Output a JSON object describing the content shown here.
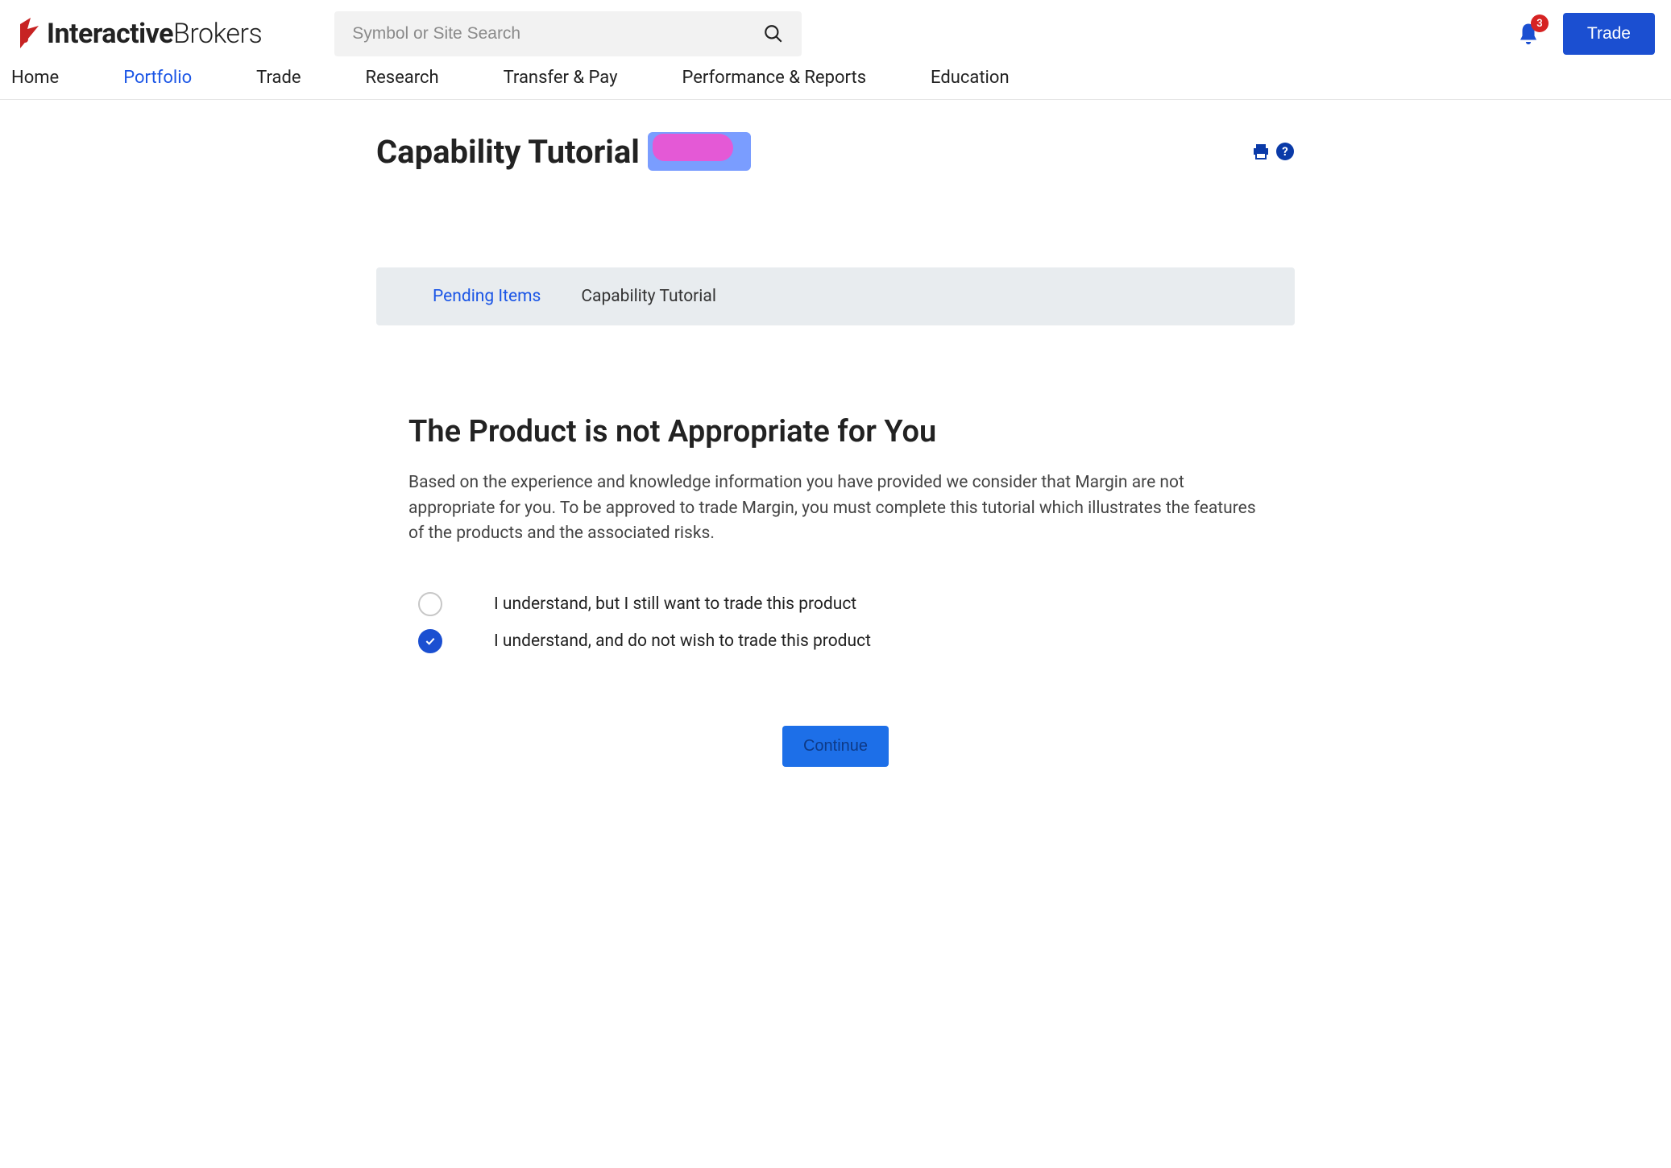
{
  "header": {
    "logo_bold": "Interactive",
    "logo_light": "Brokers",
    "search_placeholder": "Symbol or Site Search",
    "notification_count": "3",
    "trade_button": "Trade"
  },
  "nav": {
    "items": [
      {
        "label": "Home",
        "active": false
      },
      {
        "label": "Portfolio",
        "active": true
      },
      {
        "label": "Trade",
        "active": false
      },
      {
        "label": "Research",
        "active": false
      },
      {
        "label": "Transfer & Pay",
        "active": false
      },
      {
        "label": "Performance & Reports",
        "active": false
      },
      {
        "label": "Education",
        "active": false
      }
    ]
  },
  "page": {
    "title": "Capability Tutorial",
    "breadcrumb": {
      "link": "Pending Items",
      "current": "Capability Tutorial"
    }
  },
  "section": {
    "title": "The Product is not Appropriate for You",
    "body": "Based on the experience and knowledge information you have provided we consider that Margin are not appropriate for you. To be approved to trade Margin, you must complete this tutorial which illustrates the features of the products and the associated risks."
  },
  "options": [
    {
      "label": "I understand, but I still want to trade this product",
      "selected": false
    },
    {
      "label": "I understand, and do not wish to trade this product",
      "selected": true
    }
  ],
  "continue_label": "Continue"
}
